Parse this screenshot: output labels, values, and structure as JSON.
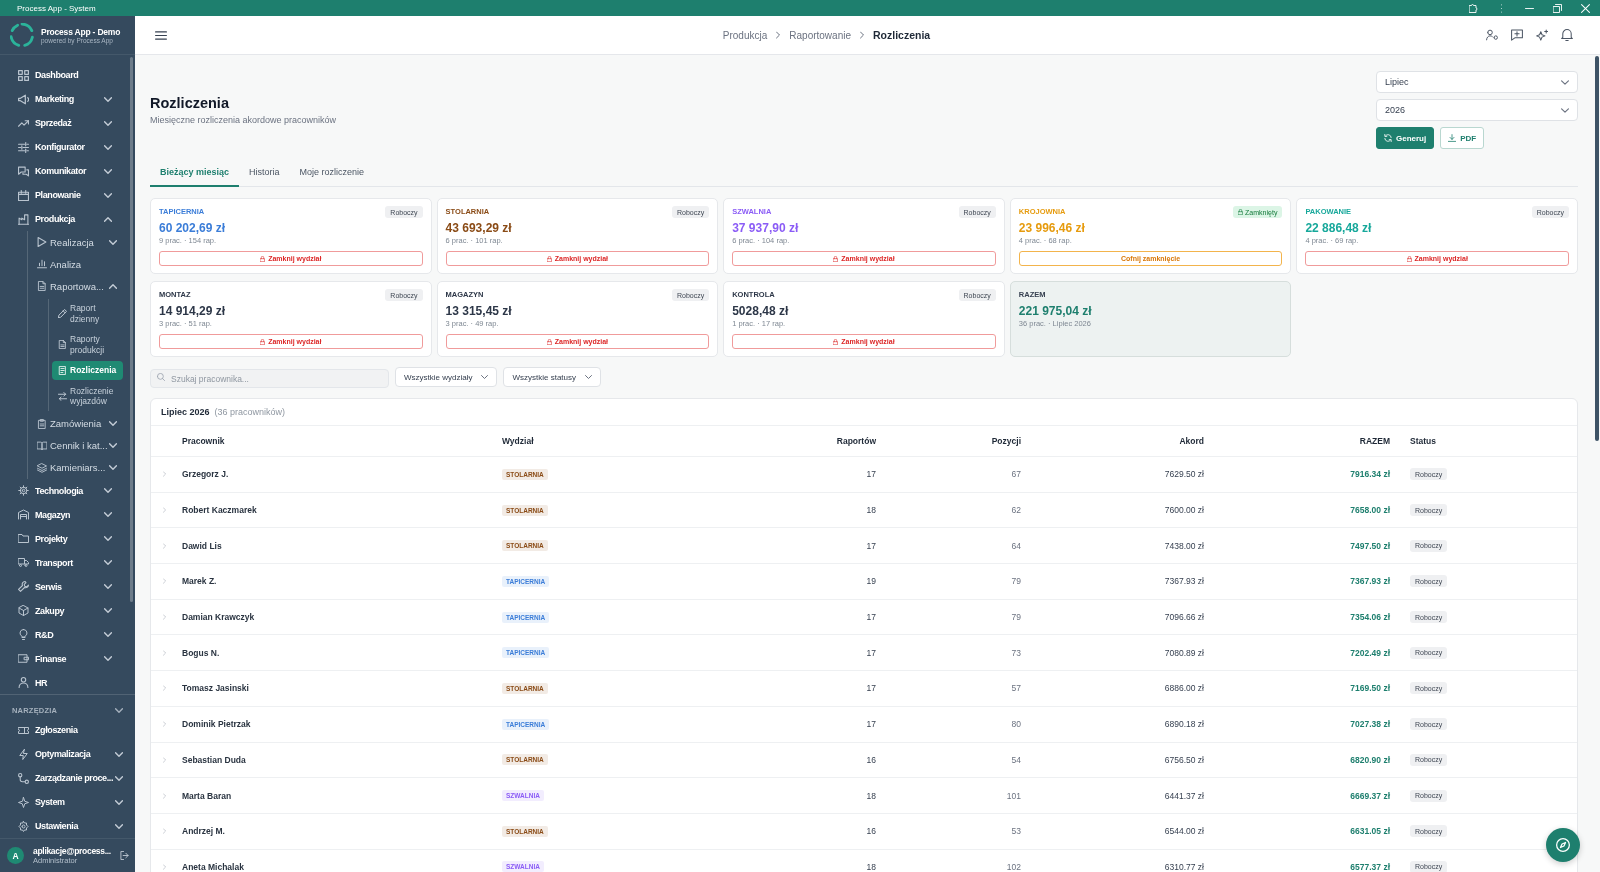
{
  "window": {
    "title": "Process App - System"
  },
  "sidebar": {
    "brand": {
      "name": "Process App - Demo",
      "tagline": "powered by Process App"
    },
    "items": [
      {
        "label": "Dashboard",
        "kind": "link",
        "selected": false
      },
      {
        "label": "Marketing",
        "kind": "group",
        "expanded": false,
        "selected": false
      },
      {
        "label": "Sprzedaż",
        "kind": "group",
        "expanded": false,
        "selected": false
      },
      {
        "label": "Konfigurator",
        "kind": "group",
        "expanded": false,
        "selected": false
      },
      {
        "label": "Komunikator",
        "kind": "group",
        "expanded": false,
        "selected": false
      },
      {
        "label": "Planowanie",
        "kind": "group",
        "expanded": false,
        "selected": false
      },
      {
        "label": "Produkcja",
        "kind": "group",
        "expanded": true,
        "selected": false,
        "children": [
          {
            "label": "Realizacja",
            "kind": "group",
            "expanded": false,
            "selected": false
          },
          {
            "label": "Analiza",
            "kind": "link",
            "selected": false
          },
          {
            "label": "Raportowa...",
            "kind": "group",
            "expanded": true,
            "selected": false,
            "children": [
              {
                "label": "Raport dzienny",
                "kind": "link",
                "selected": false
              },
              {
                "label": "Raporty produkcji",
                "kind": "link",
                "selected": false
              },
              {
                "label": "Rozliczenia",
                "kind": "link",
                "selected": true
              },
              {
                "label": "Rozliczenie wyjazdów",
                "kind": "link",
                "selected": false
              }
            ]
          },
          {
            "label": "Zamówienia",
            "kind": "group",
            "expanded": false,
            "selected": false
          },
          {
            "label": "Cennik i kat...",
            "kind": "group",
            "expanded": false,
            "selected": false
          },
          {
            "label": "Kamieniars...",
            "kind": "group",
            "expanded": false,
            "selected": false
          }
        ]
      },
      {
        "label": "Technologia",
        "kind": "group",
        "expanded": false,
        "selected": false
      },
      {
        "label": "Magazyn",
        "kind": "group",
        "expanded": false,
        "selected": false
      },
      {
        "label": "Projekty",
        "kind": "group",
        "expanded": false,
        "selected": false
      },
      {
        "label": "Transport",
        "kind": "group",
        "expanded": false,
        "selected": false
      },
      {
        "label": "Serwis",
        "kind": "group",
        "expanded": false,
        "selected": false
      },
      {
        "label": "Zakupy",
        "kind": "group",
        "expanded": false,
        "selected": false
      },
      {
        "label": "R&D",
        "kind": "group",
        "expanded": false,
        "selected": false
      },
      {
        "label": "Finanse",
        "kind": "group",
        "expanded": false,
        "selected": false
      },
      {
        "label": "HR",
        "kind": "link",
        "selected": false
      }
    ],
    "tools": {
      "heading": "NARZĘDZIA",
      "items": [
        {
          "label": "Zgłoszenia",
          "kind": "link",
          "selected": false
        },
        {
          "label": "Optymalizacja",
          "kind": "group",
          "expanded": false,
          "selected": false
        },
        {
          "label": "Zarządzanie proce...",
          "kind": "group",
          "expanded": false,
          "selected": false
        },
        {
          "label": "System",
          "kind": "group",
          "expanded": false,
          "selected": false
        },
        {
          "label": "Ustawienia",
          "kind": "group",
          "expanded": false,
          "selected": false
        }
      ]
    },
    "user": {
      "initial": "A",
      "email": "aplikacje@process...",
      "role": "Administrator"
    }
  },
  "header": {
    "breadcrumb": [
      {
        "label": "Produkcja",
        "current": false
      },
      {
        "label": "Raportowanie",
        "current": false
      },
      {
        "label": "Rozliczenia",
        "current": true
      }
    ]
  },
  "page": {
    "title": "Rozliczenia",
    "subtitle": "Miesięczne rozliczenia akordowe pracowników",
    "month": {
      "value": "Lipiec"
    },
    "year": {
      "value": "2026"
    },
    "actions": [
      {
        "label": "Generuj",
        "kind": "primary"
      },
      {
        "label": "PDF",
        "kind": "secondary"
      }
    ]
  },
  "tabs": [
    {
      "label": "Bieżący miesiąc",
      "selected": true
    },
    {
      "label": "Historia",
      "selected": false
    },
    {
      "label": "Moje rozliczenie",
      "selected": false
    }
  ],
  "departments": [
    {
      "name": "TAPICERNIA",
      "color": "#3b7dd8",
      "status": "Roboczy",
      "closed": false,
      "amount": "60 202,69 zł",
      "meta": "9 prac. · 154 rap.",
      "action": "Zamknij wydział"
    },
    {
      "name": "STOLARNIA",
      "color": "#8a4b16",
      "status": "Roboczy",
      "closed": false,
      "amount": "43 693,29 zł",
      "meta": "6 prac. · 101 rap.",
      "action": "Zamknij wydział"
    },
    {
      "name": "SZWALNIA",
      "color": "#8b5cf6",
      "status": "Roboczy",
      "closed": false,
      "amount": "37 937,90 zł",
      "meta": "6 prac. · 104 rap.",
      "action": "Zamknij wydział"
    },
    {
      "name": "KROJOWNIA",
      "color": "#e69b0e",
      "status": "Zamknięty",
      "closed": true,
      "amount": "23 996,46 zł",
      "meta": "4 prac. · 68 rap.",
      "action": "Cofnij zamknięcie"
    },
    {
      "name": "PAKOWANIE",
      "color": "#17a89b",
      "status": "Roboczy",
      "closed": false,
      "amount": "22 886,48 zł",
      "meta": "4 prac. · 69 rap.",
      "action": "Zamknij wydział"
    },
    {
      "name": "MONTAZ",
      "color": "#2d3748",
      "status": "Roboczy",
      "closed": false,
      "amount": "14 914,29 zł",
      "meta": "3 prac. · 51 rap.",
      "action": "Zamknij wydział"
    },
    {
      "name": "MAGAZYN",
      "color": "#2d3748",
      "status": "Roboczy",
      "closed": false,
      "amount": "13 315,45 zł",
      "meta": "3 prac. · 49 rap.",
      "action": "Zamknij wydział"
    },
    {
      "name": "KONTROLA",
      "color": "#2d3748",
      "status": "Roboczy",
      "closed": false,
      "amount": "5028,48 zł",
      "meta": "1 prac. · 17 rap.",
      "action": "Zamknij wydział"
    }
  ],
  "total": {
    "name": "RAZEM",
    "amount": "221 975,04 zł",
    "meta": "36 prac. · Lipiec 2026"
  },
  "filters": {
    "search": {
      "placeholder": "Szukaj pracownika..."
    },
    "department": {
      "value": "Wszystkie wydziały"
    },
    "status": {
      "value": "Wszystkie statusy"
    }
  },
  "table": {
    "caption": "Lipiec 2026",
    "count": "(36 pracowników)",
    "columns": [
      "Pracownik",
      "Wydział",
      "Raportów",
      "Pozycji",
      "Akord",
      "RAZEM",
      "Status"
    ],
    "rows": [
      {
        "name": "Grzegorz J.",
        "department": "STOLARNIA",
        "color": "#8a4b16",
        "reports": "17",
        "positions": "67",
        "akord": "7629.50 zł",
        "total": "7916.34 zł",
        "status": "Roboczy",
        "expanded": false
      },
      {
        "name": "Robert Kaczmarek",
        "department": "STOLARNIA",
        "color": "#8a4b16",
        "reports": "18",
        "positions": "62",
        "akord": "7600.00 zł",
        "total": "7658.00 zł",
        "status": "Roboczy",
        "expanded": false
      },
      {
        "name": "Dawid Lis",
        "department": "STOLARNIA",
        "color": "#8a4b16",
        "reports": "17",
        "positions": "64",
        "akord": "7438.00 zł",
        "total": "7497.50 zł",
        "status": "Roboczy",
        "expanded": false
      },
      {
        "name": "Marek Z.",
        "department": "TAPICERNIA",
        "color": "#3b7dd8",
        "reports": "19",
        "positions": "79",
        "akord": "7367.93 zł",
        "total": "7367.93 zł",
        "status": "Roboczy",
        "expanded": false
      },
      {
        "name": "Damian Krawczyk",
        "department": "TAPICERNIA",
        "color": "#3b7dd8",
        "reports": "17",
        "positions": "79",
        "akord": "7096.66 zł",
        "total": "7354.06 zł",
        "status": "Roboczy",
        "expanded": false
      },
      {
        "name": "Bogus N.",
        "department": "TAPICERNIA",
        "color": "#3b7dd8",
        "reports": "17",
        "positions": "73",
        "akord": "7080.89 zł",
        "total": "7202.49 zł",
        "status": "Roboczy",
        "expanded": false
      },
      {
        "name": "Tomasz Jasinski",
        "department": "STOLARNIA",
        "color": "#8a4b16",
        "reports": "17",
        "positions": "57",
        "akord": "6886.00 zł",
        "total": "7169.50 zł",
        "status": "Roboczy",
        "expanded": false
      },
      {
        "name": "Dominik Pietrzak",
        "department": "TAPICERNIA",
        "color": "#3b7dd8",
        "reports": "17",
        "positions": "80",
        "akord": "6890.18 zł",
        "total": "7027.38 zł",
        "status": "Roboczy",
        "expanded": false
      },
      {
        "name": "Sebastian Duda",
        "department": "STOLARNIA",
        "color": "#8a4b16",
        "reports": "16",
        "positions": "54",
        "akord": "6756.50 zł",
        "total": "6820.90 zł",
        "status": "Roboczy",
        "expanded": false
      },
      {
        "name": "Marta Baran",
        "department": "SZWALNIA",
        "color": "#8b5cf6",
        "reports": "18",
        "positions": "101",
        "akord": "6441.37 zł",
        "total": "6669.37 zł",
        "status": "Roboczy",
        "expanded": false
      },
      {
        "name": "Andrzej M.",
        "department": "STOLARNIA",
        "color": "#8a4b16",
        "reports": "16",
        "positions": "53",
        "akord": "6544.00 zł",
        "total": "6631.05 zł",
        "status": "Roboczy",
        "expanded": false
      },
      {
        "name": "Aneta Michalak",
        "department": "SZWALNIA",
        "color": "#8b5cf6",
        "reports": "18",
        "positions": "102",
        "akord": "6310.77 zł",
        "total": "6577.37 zł",
        "status": "Roboczy",
        "expanded": false
      }
    ]
  }
}
